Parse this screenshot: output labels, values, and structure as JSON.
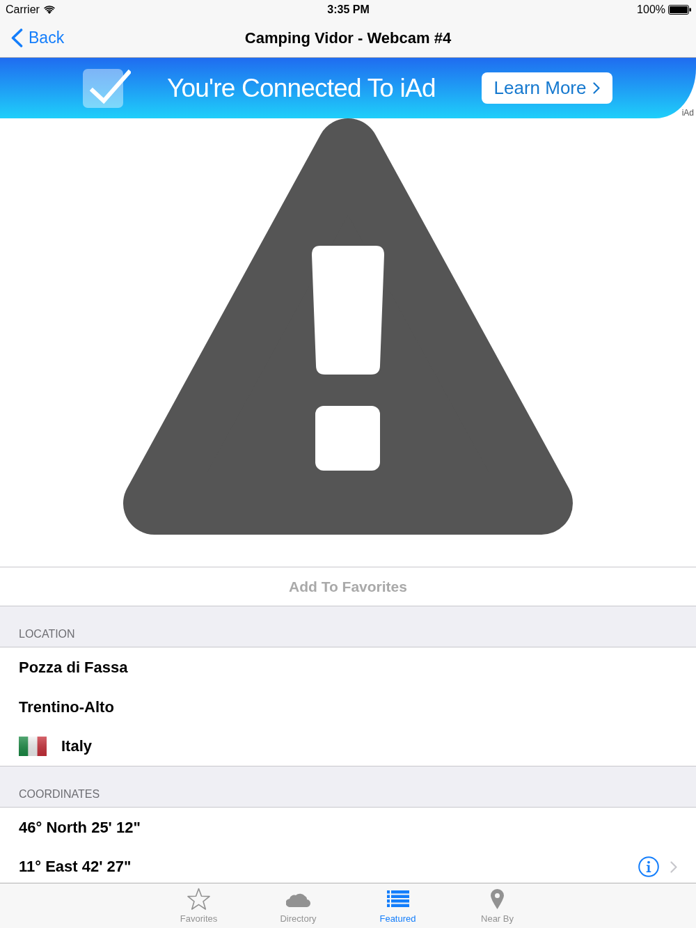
{
  "status_bar": {
    "carrier": "Carrier",
    "time": "3:35 PM",
    "battery": "100%"
  },
  "nav_bar": {
    "back": "Back",
    "title": "Camping Vidor - Webcam #4"
  },
  "ad_banner": {
    "headline": "You're Connected To iAd",
    "button": "Learn More",
    "badge": "iAd"
  },
  "add_to_favorites": {
    "label": "Add To Favorites",
    "disabled": true
  },
  "sections": [
    {
      "header": "LOCATION",
      "rows": [
        {
          "kind": "text",
          "label": "Pozza di Fassa"
        },
        {
          "kind": "text",
          "label": "Trentino-Alto"
        },
        {
          "kind": "flag",
          "label": "Italy"
        }
      ]
    },
    {
      "header": "COORDINATES",
      "rows": [
        {
          "kind": "text",
          "label": "46° North 25' 12\""
        },
        {
          "kind": "detail",
          "label": "11° East 42' 27\""
        }
      ]
    }
  ],
  "tab_bar": {
    "tabs": [
      {
        "label": "Favorites",
        "selected": false
      },
      {
        "label": "Directory",
        "selected": false
      },
      {
        "label": "Featured",
        "selected": true
      },
      {
        "label": "Near By",
        "selected": false
      }
    ]
  }
}
